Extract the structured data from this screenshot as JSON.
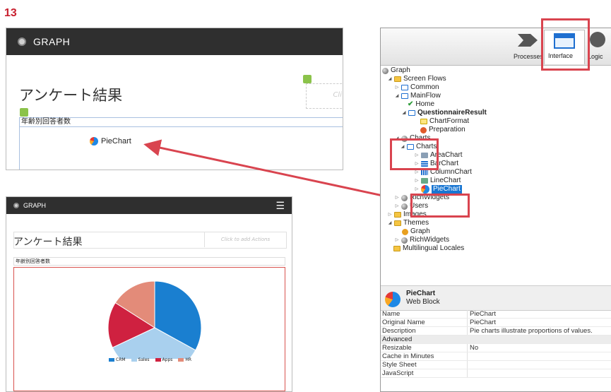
{
  "step_number": "13",
  "designer_preview": {
    "app_name": "GRAPH",
    "page_title": "アンケート結果",
    "actions_placeholder": "Cli",
    "section_label": "年齢別回答者数",
    "webblock_label": "PieChart"
  },
  "browser_preview": {
    "app_name": "GRAPH",
    "menu_icon": "hamburger-icon",
    "page_title": "アンケート結果",
    "actions_placeholder": "Click to add Actions",
    "section_label": "年齢別回答者数",
    "chart_data": {
      "type": "pie",
      "categories": [
        "CRM",
        "Sales",
        "Apps",
        "HR"
      ],
      "values": [
        33,
        35,
        16,
        16
      ],
      "colors": [
        "#1a7fd0",
        "#a9d0ee",
        "#cf2140",
        "#e38b79"
      ],
      "legend": "bottom"
    }
  },
  "ide": {
    "tabs": [
      {
        "label": "Processes",
        "active": false
      },
      {
        "label": "Interface",
        "active": true
      },
      {
        "label": "Logic",
        "active": false
      }
    ],
    "tree": [
      {
        "label": "Graph",
        "icon": "globe-icon"
      },
      {
        "label": "Screen Flows",
        "icon": "folder-icon"
      },
      {
        "label": "Common",
        "icon": "flow-icon"
      },
      {
        "label": "MainFlow",
        "icon": "flow-icon"
      },
      {
        "label": "Home",
        "icon": "check-icon"
      },
      {
        "label": "QuestionnaireResult",
        "icon": "screen-icon"
      },
      {
        "label": "ChartFormat",
        "icon": "block-icon"
      },
      {
        "label": "Preparation",
        "icon": "preparation-icon"
      },
      {
        "label": "Charts",
        "icon": "globe-icon"
      },
      {
        "label": "Charts",
        "icon": "flow-icon"
      },
      {
        "label": "AreaChart",
        "icon": "area-chart-icon"
      },
      {
        "label": "BarChart",
        "icon": "bar-chart-icon"
      },
      {
        "label": "ColumnChart",
        "icon": "column-chart-icon"
      },
      {
        "label": "LineChart",
        "icon": "line-chart-icon"
      },
      {
        "label": "PieChart",
        "icon": "pie-chart-icon"
      },
      {
        "label": "RichWidgets",
        "icon": "globe-icon"
      },
      {
        "label": "Users",
        "icon": "globe-icon"
      },
      {
        "label": "Images",
        "icon": "folder-icon"
      },
      {
        "label": "Themes",
        "icon": "folder-icon"
      },
      {
        "label": "Graph",
        "icon": "theme-icon"
      },
      {
        "label": "RichWidgets",
        "icon": "globe-icon"
      },
      {
        "label": "Multilingual Locales",
        "icon": "folder-icon"
      }
    ],
    "selected_item": "PieChart",
    "properties_header": {
      "title": "PieChart",
      "subtitle": "Web Block"
    },
    "properties": [
      {
        "key": "Name",
        "value": "PieChart"
      },
      {
        "key": "Original Name",
        "value": "PieChart"
      },
      {
        "key": "Description",
        "value": "Pie charts illustrate proportions of values."
      }
    ],
    "advanced_group": "Advanced",
    "advanced_properties": [
      {
        "key": "Resizable",
        "value": "No"
      },
      {
        "key": "Cache in Minutes",
        "value": ""
      },
      {
        "key": "Style Sheet",
        "value": ""
      },
      {
        "key": "JavaScript",
        "value": ""
      }
    ]
  }
}
